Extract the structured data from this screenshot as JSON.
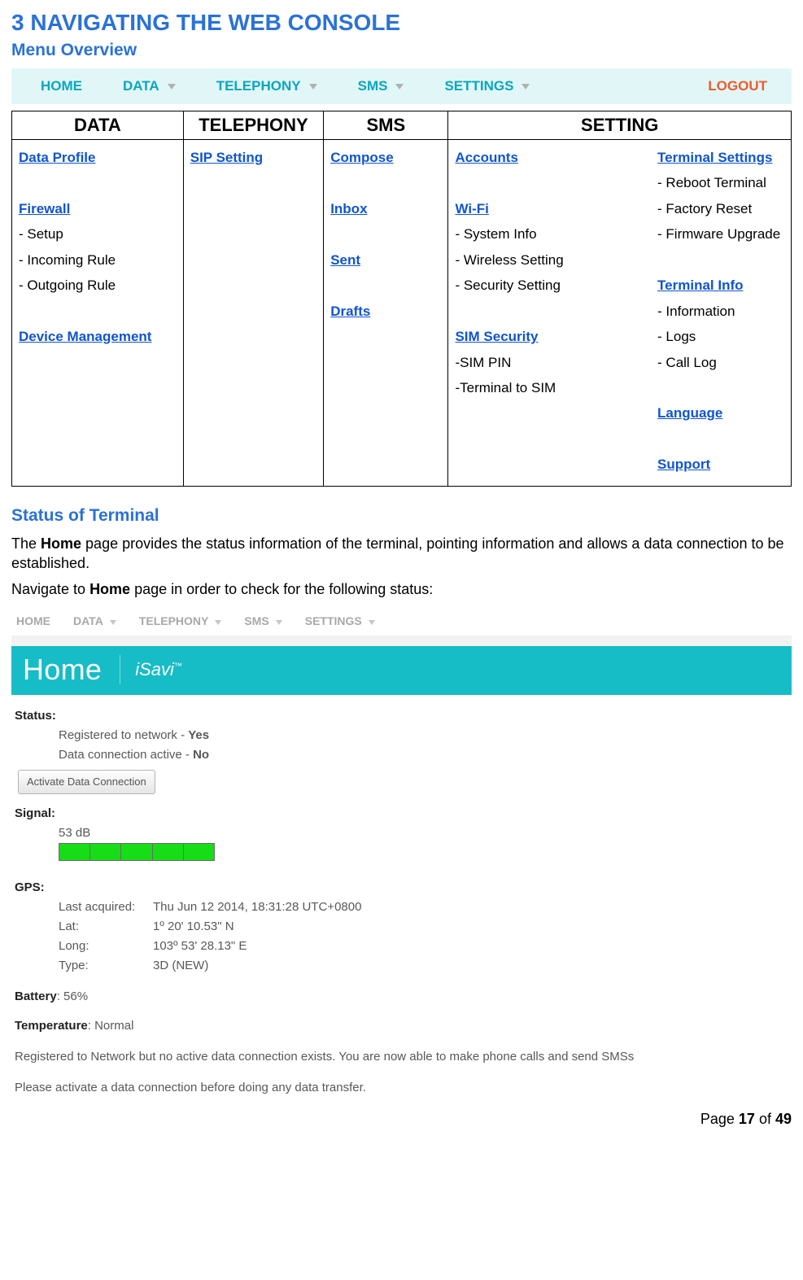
{
  "heading1": "3 NAVIGATING THE WEB CONSOLE",
  "heading2": "Menu Overview",
  "nav1": {
    "home": "HOME",
    "data": "DATA",
    "telephony": "TELEPHONY",
    "sms": "SMS",
    "settings": "SETTINGS",
    "logout": "LOGOUT"
  },
  "table": {
    "headers": {
      "c1": "DATA",
      "c2": "TELEPHONY",
      "c3": "SMS",
      "c4": "SETTING"
    },
    "data": {
      "data_profile": "Data Profile",
      "firewall": "Firewall",
      "fw_setup": "- Setup",
      "fw_in": "- Incoming Rule",
      "fw_out": "- Outgoing Rule",
      "dev_mgmt": "Device Management"
    },
    "telephony": {
      "sip": "SIP Setting"
    },
    "sms": {
      "compose": "Compose",
      "inbox": "Inbox",
      "sent": "Sent",
      "drafts": "Drafts"
    },
    "setting_a": {
      "accounts": "Accounts",
      "wifi": "Wi-Fi",
      "wifi_sys": "- System Info",
      "wifi_wl": "- Wireless Setting",
      "wifi_sec": "- Security Setting",
      "sim": "SIM Security",
      "sim_pin": "-SIM PIN",
      "sim_term": "-Terminal to SIM"
    },
    "setting_b": {
      "ts": "Terminal Settings",
      "ts_reboot": "- Reboot Terminal",
      "ts_factory": "- Factory Reset",
      "ts_fw": "- Firmware Upgrade",
      "ti": "Terminal Info",
      "ti_info": "- Information",
      "ti_logs": "- Logs",
      "ti_call": "- Call Log",
      "lang": "Language",
      "support": "Support"
    }
  },
  "heading3": "Status of Terminal",
  "para1_a": "The ",
  "para1_b": "Home",
  "para1_c": " page provides the status information of the terminal,  pointing information and allows a data connection to be established.",
  "para2_a": "Navigate to ",
  "para2_b": "Home",
  "para2_c": " page in order to check for the following status:",
  "nav2": {
    "home": "HOME",
    "data": "DATA",
    "telephony": "TELEPHONY",
    "sms": "SMS",
    "settings": "SETTINGS"
  },
  "tealbar": {
    "home": "Home",
    "isavi": "iSavi",
    "tm": "™"
  },
  "status": {
    "status_lbl": "Status:",
    "reg_a": "Registered to network - ",
    "reg_b": "Yes",
    "dca_a": "Data connection active - ",
    "dca_b": "No",
    "activate_btn": "Activate Data Connection",
    "signal_lbl": "Signal:",
    "signal_val": "53 dB",
    "gps_lbl": "GPS:",
    "gps_last_k": "Last acquired:",
    "gps_last_v": "Thu Jun 12 2014, 18:31:28 UTC+0800",
    "gps_lat_k": "Lat:",
    "gps_lat_v": "1º 20' 10.53\" N",
    "gps_lon_k": "Long:",
    "gps_lon_v": "103º 53' 28.13\" E",
    "gps_type_k": "Type:",
    "gps_type_v": "3D (NEW)",
    "batt_lbl": "Battery",
    "batt_val": ": 56%",
    "temp_lbl": "Temperature",
    "temp_val": ": Normal",
    "msg1": "Registered to Network but no active data connection exists. You are now able to make phone calls and send SMSs",
    "msg2": "Please activate a data connection before doing any data transfer."
  },
  "footer": {
    "a": "Page ",
    "b": "17",
    "c": " of ",
    "d": "49"
  }
}
